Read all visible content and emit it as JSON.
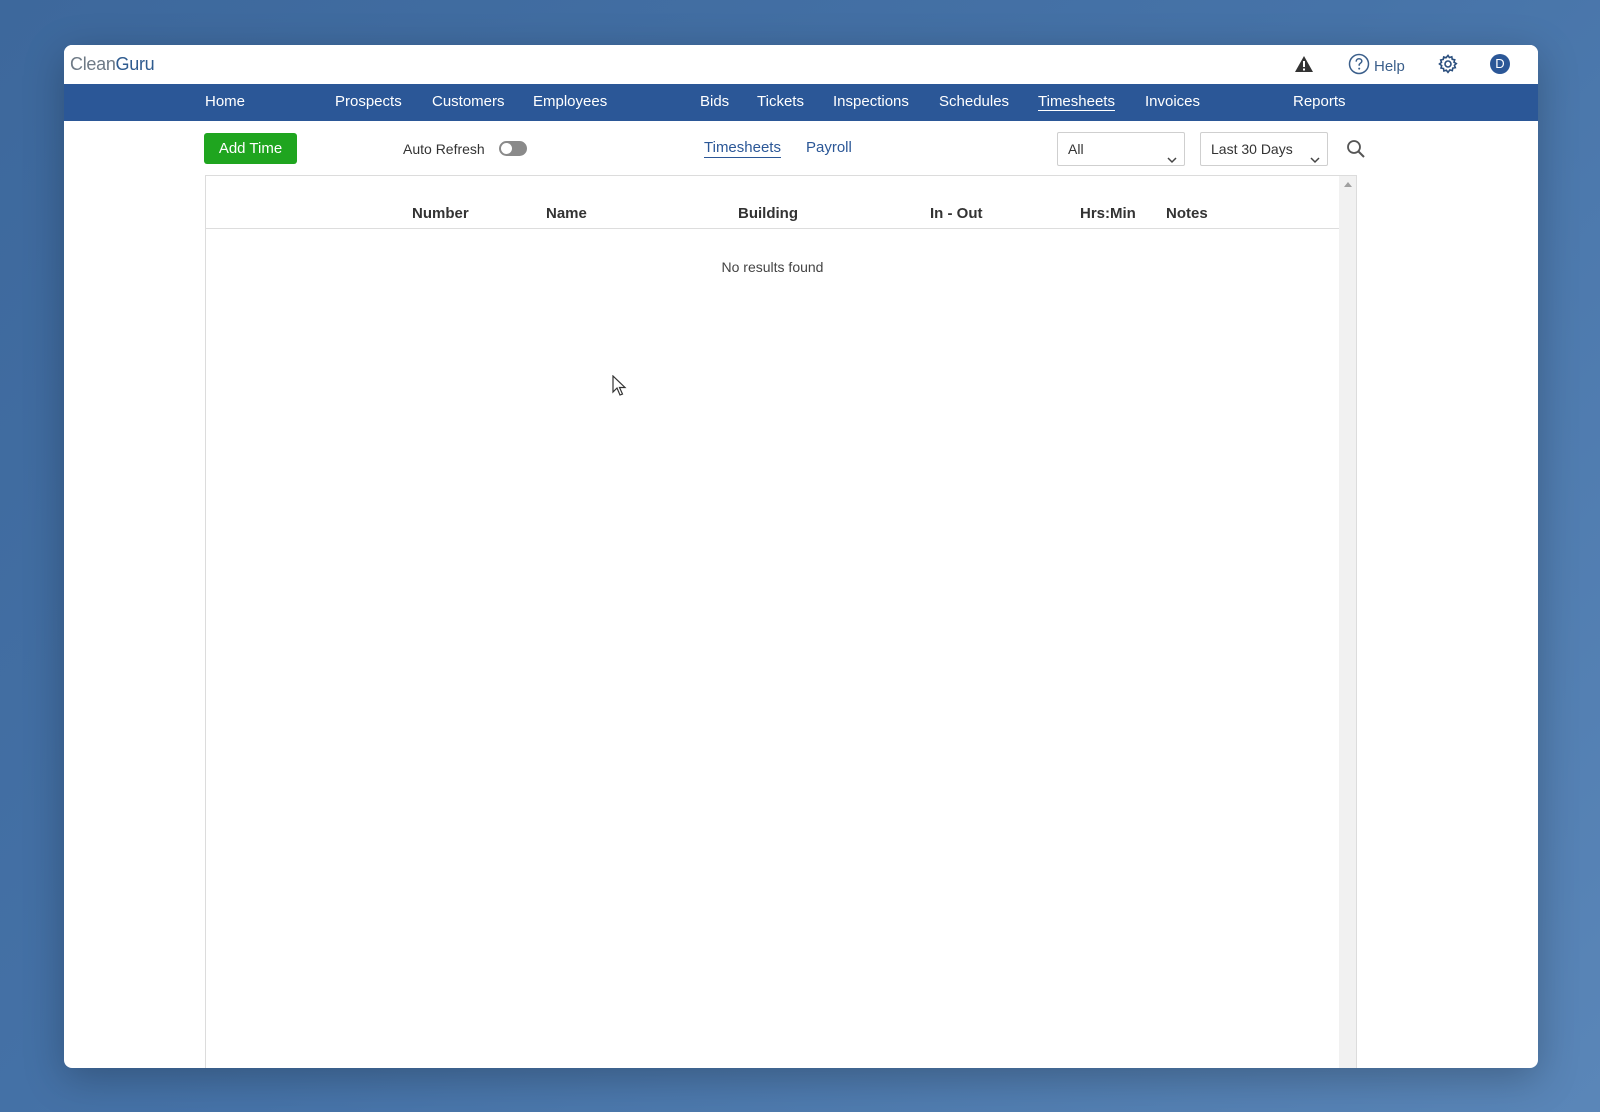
{
  "app": {
    "logo_part1": "Clean",
    "logo_part2": "Guru"
  },
  "header": {
    "help_label": "Help",
    "avatar_initial": "D",
    "icons": [
      "warning-icon",
      "help-icon",
      "gear-icon"
    ]
  },
  "nav": {
    "items": [
      {
        "label": "Home"
      },
      {
        "label": "Prospects"
      },
      {
        "label": "Customers"
      },
      {
        "label": "Employees"
      },
      {
        "label": "Bids"
      },
      {
        "label": "Tickets"
      },
      {
        "label": "Inspections"
      },
      {
        "label": "Schedules"
      },
      {
        "label": "Timesheets",
        "active": true
      },
      {
        "label": "Invoices"
      },
      {
        "label": "Reports"
      }
    ]
  },
  "toolbar": {
    "add_label": "Add Time",
    "auto_refresh_label": "Auto Refresh",
    "auto_refresh_on": false,
    "subtabs": [
      {
        "label": "Timesheets",
        "active": true
      },
      {
        "label": "Payroll",
        "active": false
      }
    ],
    "filter_value": "All",
    "range_value": "Last 30 Days"
  },
  "table": {
    "columns": [
      "Number",
      "Name",
      "Building",
      "In - Out",
      "Hrs:Min",
      "Notes"
    ],
    "rows": [],
    "empty_message": "No results found"
  },
  "colors": {
    "nav_bg": "#2b5797",
    "add_button": "#1fa51f",
    "link": "#2b5797"
  }
}
